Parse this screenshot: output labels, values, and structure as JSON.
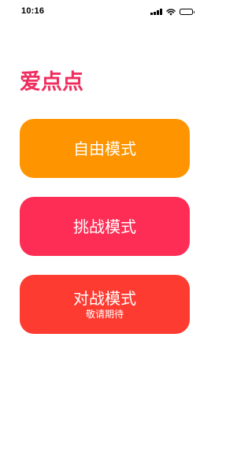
{
  "status_bar": {
    "time": "10:16",
    "icons": [
      "signal-icon",
      "wifi-icon",
      "battery-icon"
    ]
  },
  "app": {
    "title": "爱点点",
    "title_color": "#ef2d5e"
  },
  "modes": [
    {
      "label": "自由模式",
      "sublabel": "",
      "color": "#fe9500"
    },
    {
      "label": "挑战模式",
      "sublabel": "",
      "color": "#fe2d55"
    },
    {
      "label": "对战模式",
      "sublabel": "敬请期待",
      "color": "#fe3b30"
    }
  ]
}
